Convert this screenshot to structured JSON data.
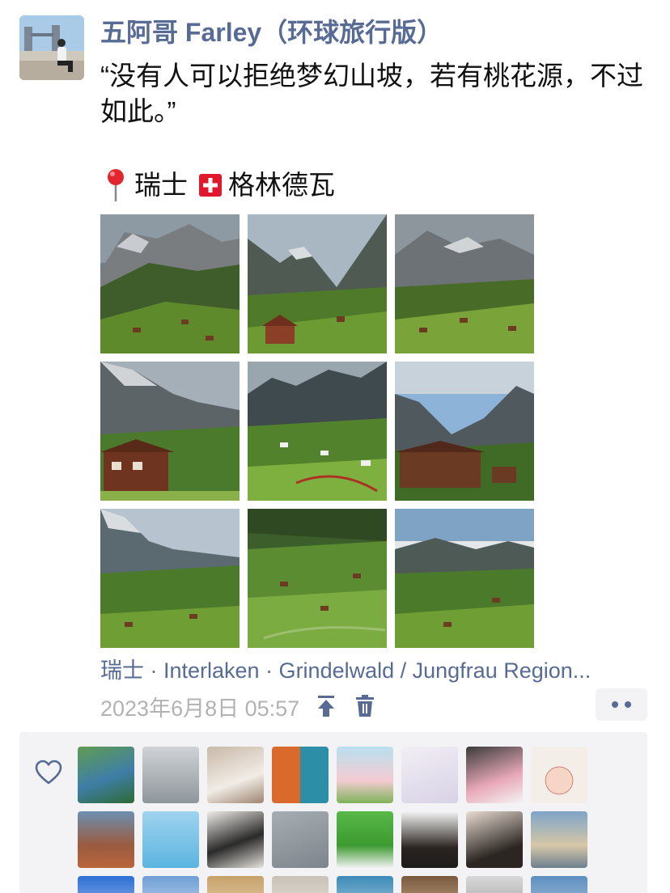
{
  "post": {
    "author": "五阿哥 Farley（环球旅行版）",
    "text": "“没有人可以拒绝梦幻山坡，若有桃花源，不过如此。”",
    "location_line": {
      "pin_icon": "round-pushpin-icon",
      "country": "瑞士",
      "flag_icon": "swiss-flag-icon",
      "place": "格林德瓦"
    },
    "photos": [
      {
        "icon": "mountain-village-photo"
      },
      {
        "icon": "mountain-village-photo"
      },
      {
        "icon": "mountain-village-photo"
      },
      {
        "icon": "mountain-chalet-photo"
      },
      {
        "icon": "mountain-village-photo"
      },
      {
        "icon": "mountain-chalet-photo"
      },
      {
        "icon": "mountain-valley-photo"
      },
      {
        "icon": "mountain-valley-photo"
      },
      {
        "icon": "mountain-valley-photo"
      }
    ],
    "place_link": "瑞士 · Interlaken · Grindelwald / Jungfrau Region...",
    "timestamp": "2023年6月8日 05:57",
    "actions": {
      "pin_icon": "pin-to-top-icon",
      "delete_icon": "trash-icon",
      "more_icon": "more-dots-icon"
    }
  },
  "likes": {
    "heart_icon": "heart-outline-icon",
    "liker_count_visible": 24
  },
  "colors": {
    "link": "#576b95",
    "text": "#111111",
    "muted": "#b2b2b2",
    "panel": "#f3f3f5"
  }
}
